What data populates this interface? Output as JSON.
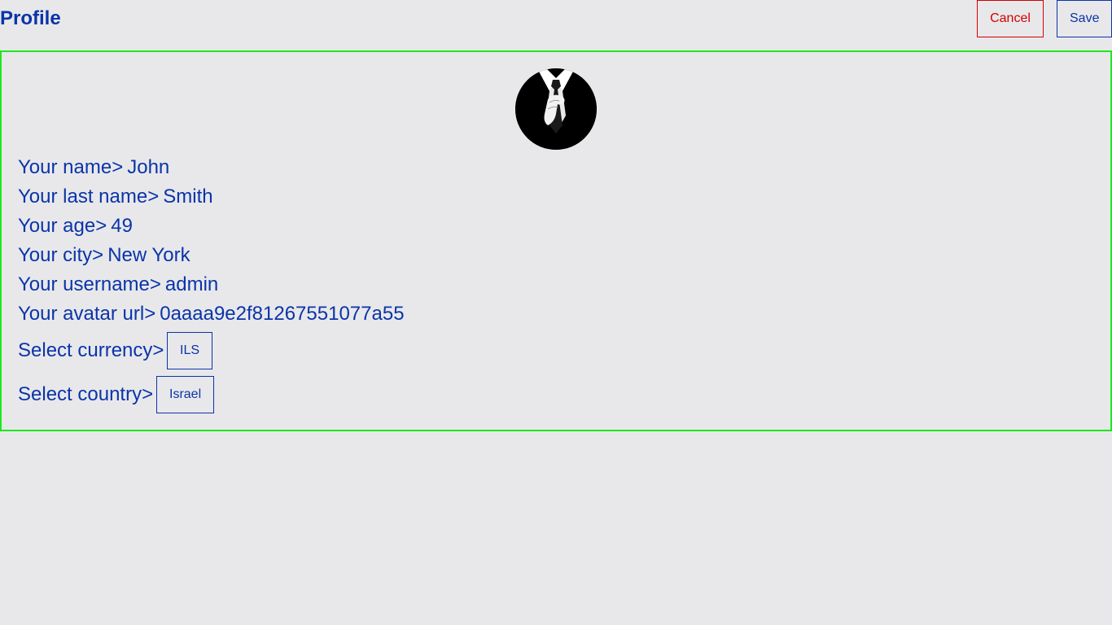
{
  "header": {
    "title": "Profile",
    "cancel_label": "Cancel",
    "save_label": "Save"
  },
  "profile": {
    "avatar_icon": "suit-tie-avatar-icon",
    "fields": [
      {
        "label": "Your name>",
        "value": "John"
      },
      {
        "label": "Your last name>",
        "value": "Smith"
      },
      {
        "label": "Your age>",
        "value": "49"
      },
      {
        "label": "Your city>",
        "value": "New York"
      },
      {
        "label": "Your username>",
        "value": "admin"
      },
      {
        "label": "Your avatar url>",
        "value": "0aaaa9e2f81267551077a55"
      }
    ],
    "currency": {
      "label": "Select currency>",
      "value": "ILS"
    },
    "country": {
      "label": "Select country>",
      "value": "Israel"
    }
  },
  "colors": {
    "text": "#0a34a8",
    "cancel": "#d40000",
    "panel_border": "#1ee81e",
    "background": "#e8e8eb"
  }
}
